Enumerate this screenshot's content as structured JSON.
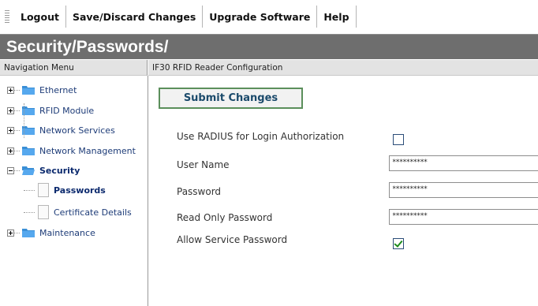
{
  "toolbar": {
    "items": [
      "Logout",
      "Save/Discard Changes",
      "Upgrade Software",
      "Help"
    ]
  },
  "page_title": "Security/Passwords/",
  "nav": {
    "header": "Navigation Menu",
    "items": [
      {
        "label": "Ethernet",
        "icon": "folder-icon"
      },
      {
        "label": "RFID Module",
        "icon": "folder-icon"
      },
      {
        "label": "Network Services",
        "icon": "folder-icon"
      },
      {
        "label": "Network Management",
        "icon": "folder-icon"
      },
      {
        "label": "Security",
        "icon": "folder-icon"
      },
      {
        "label": "Maintenance",
        "icon": "folder-icon"
      }
    ],
    "sub_items": [
      {
        "label": "Passwords",
        "icon": "document-icon"
      },
      {
        "label": "Certificate Details",
        "icon": "document-icon"
      }
    ]
  },
  "main": {
    "header": "IF30 RFID Reader Configuration",
    "submit_label": "Submit Changes",
    "fields": {
      "radius_label": "Use RADIUS for Login Authorization",
      "radius_checked": false,
      "username_label": "User Name",
      "username_value": "**********",
      "password_label": "Password",
      "password_value": "**********",
      "readonly_label": "Read Only Password",
      "readonly_value": "**********",
      "service_label": "Allow Service Password",
      "service_checked": true
    }
  },
  "colors": {
    "title_bar": "#6e6e6e",
    "button_border": "#5b8f5b",
    "folder": "#3a8fd6",
    "nav_text": "#1e3c78"
  }
}
